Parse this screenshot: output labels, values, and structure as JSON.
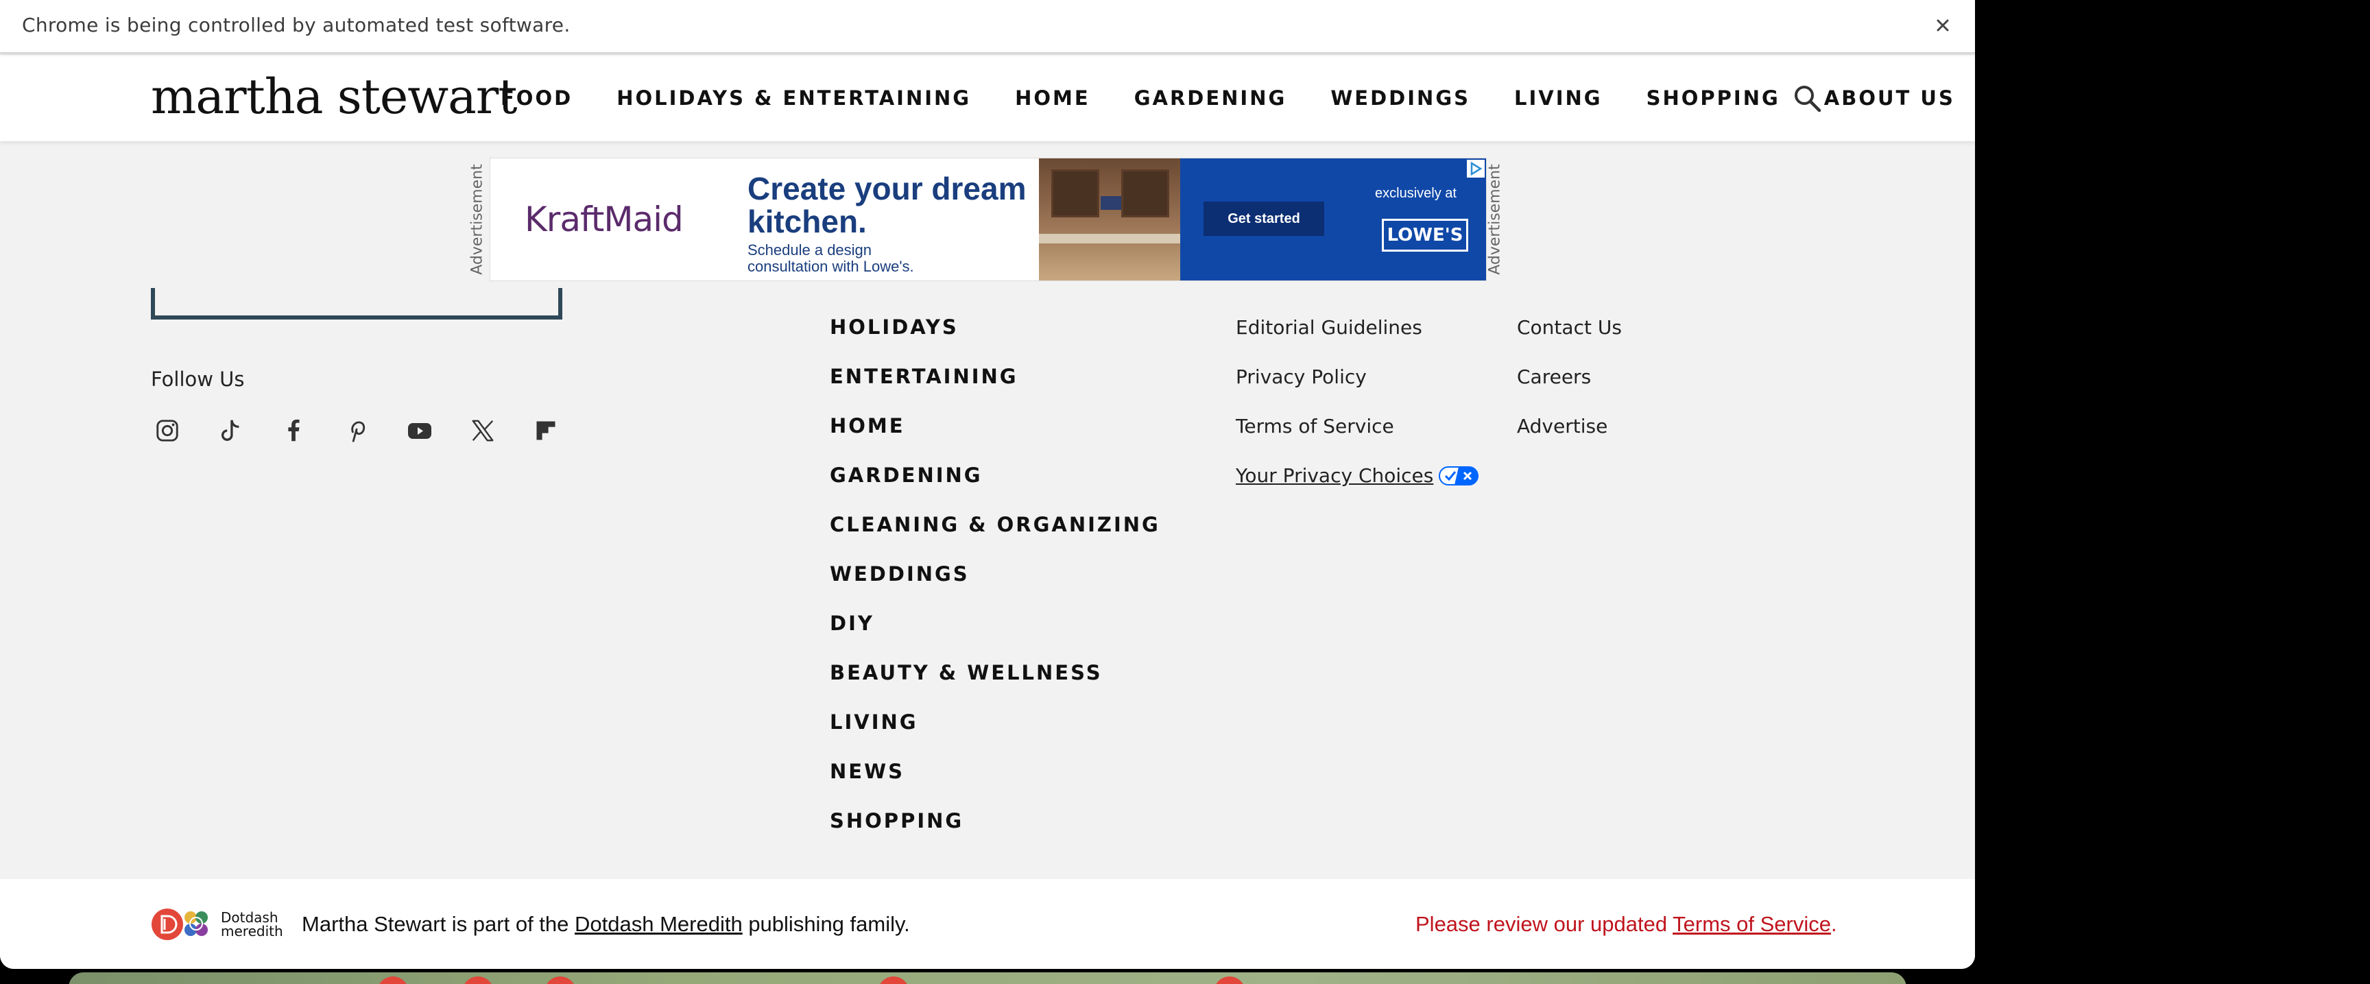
{
  "browser": {
    "infobar_message": "Chrome is being controlled by automated test software.",
    "close_icon": "close-icon"
  },
  "header": {
    "logo": "martha stewart",
    "nav": [
      "FOOD",
      "HOLIDAYS & ENTERTAINING",
      "HOME",
      "GARDENING",
      "WEDDINGS",
      "LIVING",
      "SHOPPING",
      "ABOUT US"
    ],
    "search_icon": "search-icon"
  },
  "ad": {
    "label": "Advertisement",
    "brand": "KraftMaid",
    "headline": "Create your dream kitchen.",
    "subtext": "Schedule a design consultation with Lowe's.",
    "cta": "Get started",
    "tagline": "exclusively at",
    "retailer": "LOWE'S"
  },
  "footer": {
    "follow_label": "Follow Us",
    "social": [
      "instagram-icon",
      "tiktok-icon",
      "facebook-icon",
      "pinterest-icon",
      "youtube-icon",
      "x-icon",
      "flipboard-icon"
    ],
    "categories": [
      "HOLIDAYS",
      "ENTERTAINING",
      "HOME",
      "GARDENING",
      "CLEANING & ORGANIZING",
      "WEDDINGS",
      "DIY",
      "BEAUTY & WELLNESS",
      "LIVING",
      "NEWS",
      "SHOPPING"
    ],
    "links_col1": [
      "Editorial Guidelines",
      "Privacy Policy",
      "Terms of Service",
      "Your Privacy Choices"
    ],
    "links_col2": [
      "Contact Us",
      "Careers",
      "Advertise"
    ]
  },
  "bottom": {
    "dd_logo_text_1": "Dotdash",
    "dd_logo_text_2": "meredith",
    "family_prefix": "Martha Stewart is part of the ",
    "family_link": "Dotdash Meredith",
    "family_suffix": " publishing family.",
    "tos_prefix": "Please review our updated ",
    "tos_link": "Terms of Service",
    "tos_suffix": ".",
    "tos_color": "#c0141d"
  }
}
